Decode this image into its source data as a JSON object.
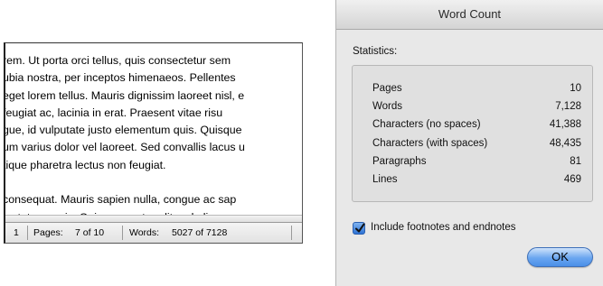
{
  "document": {
    "lines": [
      "rem. Ut porta orci tellus, quis consectetur sem",
      "ubia nostra, per inceptos himenaeos. Pellentes",
      "eget lorem tellus. Mauris dignissim laoreet nisl, e",
      " feugiat ac, lacinia in erat. Praesent vitae risu",
      "gue, id vulputate justo elementum quis. Quisque",
      "um varius dolor vel laoreet. Sed convallis lacus u",
      "tique pharetra lectus non feugiat."
    ],
    "lines2": [
      "consequat. Mauris sapien nulla, congue ac sap",
      "lputate mauris. Quisque auctor elit sed aliqu"
    ],
    "status": {
      "section": "1",
      "pages_label": "Pages:",
      "pages_value": "7 of 10",
      "words_label": "Words:",
      "words_value": "5027 of 7128"
    }
  },
  "dialog": {
    "title": "Word Count",
    "statistics_label": "Statistics:",
    "rows": [
      {
        "label": "Pages",
        "value": "10"
      },
      {
        "label": "Words",
        "value": "7,128"
      },
      {
        "label": "Characters (no spaces)",
        "value": "41,388"
      },
      {
        "label": "Characters (with spaces)",
        "value": "48,435"
      },
      {
        "label": "Paragraphs",
        "value": "81"
      },
      {
        "label": "Lines",
        "value": "469"
      }
    ],
    "checkbox_label": "Include footnotes and endnotes",
    "checkbox_checked": true,
    "ok_label": "OK"
  }
}
